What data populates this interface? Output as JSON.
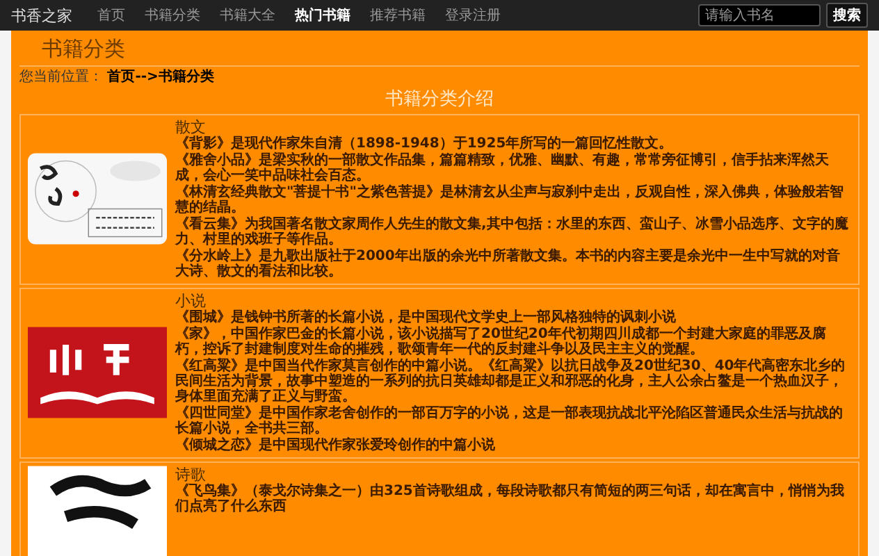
{
  "navbar": {
    "brand": "书香之家",
    "items": [
      {
        "label": "首页",
        "selected": false
      },
      {
        "label": "书籍分类",
        "selected": false
      },
      {
        "label": "书籍大全",
        "selected": false
      },
      {
        "label": "热门书籍",
        "selected": true
      },
      {
        "label": "推荐书籍",
        "selected": false
      },
      {
        "label": "登录注册",
        "selected": false
      }
    ],
    "search": {
      "placeholder": "请输入书名",
      "button": "搜索"
    }
  },
  "page_header": "书籍分类",
  "breadcrumb": {
    "label": "您当前位置：",
    "path": "首页-->书籍分类"
  },
  "section_title": "书籍分类介绍",
  "categories": [
    {
      "kind": "prose",
      "title": "散文",
      "paragraphs": [
        "《背影》是现代作家朱自清（1898-1948）于1925年所写的一篇回忆性散文。",
        "《雅舍小品》是梁实秋的一部散文作品集，篇篇精致，优雅、幽默、有趣，常常旁征博引，信手拈来浑然天成，会心一笑中品味社会百态。",
        "《林清玄经典散文\"菩提十书\"之紫色菩提》是林清玄从尘声与寂刹中走出，反观自性，深入佛典，体验般若智慧的结晶。",
        "《看云集》为我国著名散文家周作人先生的散文集,其中包括：水里的东西、蛮山子、冰雪小品选序、文字的魔力、村里的戏班子等作品。",
        "《分水岭上》是九歌出版社于2000年出版的余光中所著散文集。本书的内容主要是余光中一生中写就的对音大诗、散文的看法和比较。"
      ]
    },
    {
      "kind": "novel",
      "title": "小说",
      "paragraphs": [
        "《围城》是钱钟书所著的长篇小说，是中国现代文学史上一部风格独特的讽刺小说",
        "《家》，中国作家巴金的长篇小说，该小说描写了20世纪20年代初期四川成都一个封建大家庭的罪恶及腐朽，控诉了封建制度对生命的摧残，歌颂青年一代的反封建斗争以及民主主义的觉醒。",
        "《红高粱》是中国当代作家莫言创作的中篇小说。《红高粱》以抗日战争及20世纪30、40年代高密东北乡的民间生活为背景，故事中塑造的一系列的抗日英雄却都是正义和邪恶的化身，主人公余占鳌是一个热血汉子，身体里面充满了正义与野蛮。",
        "《四世同堂》是中国作家老舍创作的一部百万字的小说，这是一部表现抗战北平沦陷区普通民众生活与抗战的长篇小说，全书共三部。",
        "《倾城之恋》是中国现代作家张爱玲创作的中篇小说"
      ]
    },
    {
      "kind": "poetry",
      "title": "诗歌",
      "paragraphs": [
        "《飞鸟集》（泰戈尔诗集之一）由325首诗歌组成，每段诗歌都只有简短的两三句话，却在寓言中，悄悄为我们点亮了什么东西"
      ]
    }
  ]
}
